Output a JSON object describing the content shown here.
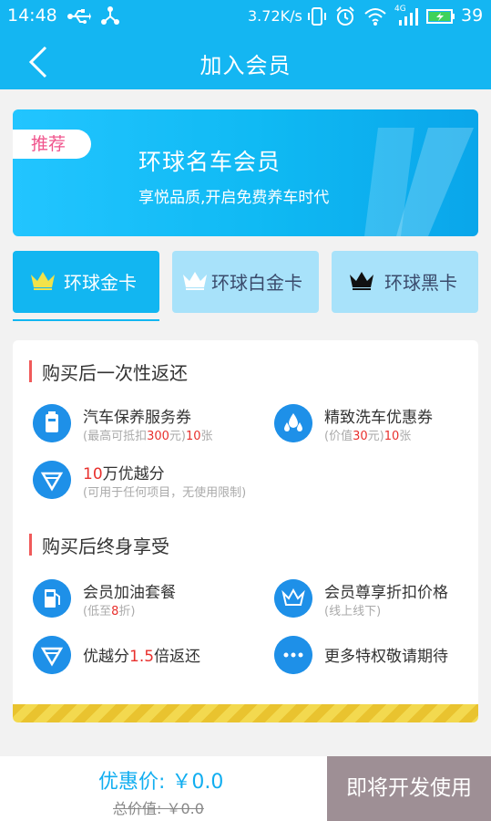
{
  "status_bar": {
    "time": "14:48",
    "speed": "3.72K/s",
    "network": "4G",
    "battery": "39",
    "icons": [
      "usb-icon",
      "share-icon",
      "vibrate-icon",
      "alarm-icon",
      "wifi-icon",
      "signal-icon",
      "battery-icon"
    ]
  },
  "nav": {
    "title": "加入会员",
    "back_icon": "chevron-left-icon"
  },
  "banner": {
    "tag": "推荐",
    "name": "环球名车会员",
    "slogan": "享悦品质,开启免费养车时代"
  },
  "tabs": [
    {
      "label": "环球金卡",
      "active": true,
      "crown_color": "#f1e24a"
    },
    {
      "label": "环球白金卡",
      "active": false,
      "crown_color": "#ffffff"
    },
    {
      "label": "环球黑卡",
      "active": false,
      "crown_color": "#111111"
    }
  ],
  "section1": {
    "title": "购买后一次性返还",
    "items": [
      {
        "icon": "car-service-icon",
        "title": "汽车保养服务券",
        "sub_pre": "(最高可抵扣",
        "sub_red": "300",
        "sub_mid": "元)",
        "sub_red2": "10",
        "sub_post": "张"
      },
      {
        "icon": "water-drops-icon",
        "title": "精致洗车优惠券",
        "sub_pre": "(价值",
        "sub_red": "30",
        "sub_mid": "元)",
        "sub_red2": "10",
        "sub_post": "张"
      },
      {
        "icon": "diamond-icon",
        "title_red": "10",
        "title_post": "万优越分",
        "sub": "(可用于任何项目，无使用限制)"
      }
    ]
  },
  "section2": {
    "title": "购买后终身享受",
    "items": [
      {
        "icon": "fuel-icon",
        "title": "会员加油套餐",
        "sub_pre": "(低至",
        "sub_red": "8",
        "sub_post": "折)"
      },
      {
        "icon": "crown-outline-icon",
        "title": "会员尊享折扣价格",
        "sub": "(线上线下)"
      },
      {
        "icon": "diamond-icon",
        "title_pre": "优越分",
        "title_red": "1.5",
        "title_post": "倍返还"
      },
      {
        "icon": "more-dots-icon",
        "title": "更多特权敬请期待"
      }
    ]
  },
  "colors": {
    "primary": "#14b6f2",
    "accent_red": "#e8302d",
    "button_gray": "#9e8f95",
    "stripe_gold": "#e9c32f"
  },
  "bottom": {
    "price": "优惠价: ￥0.0",
    "total": "总价值: ￥0.0",
    "button": "即将开发使用"
  }
}
